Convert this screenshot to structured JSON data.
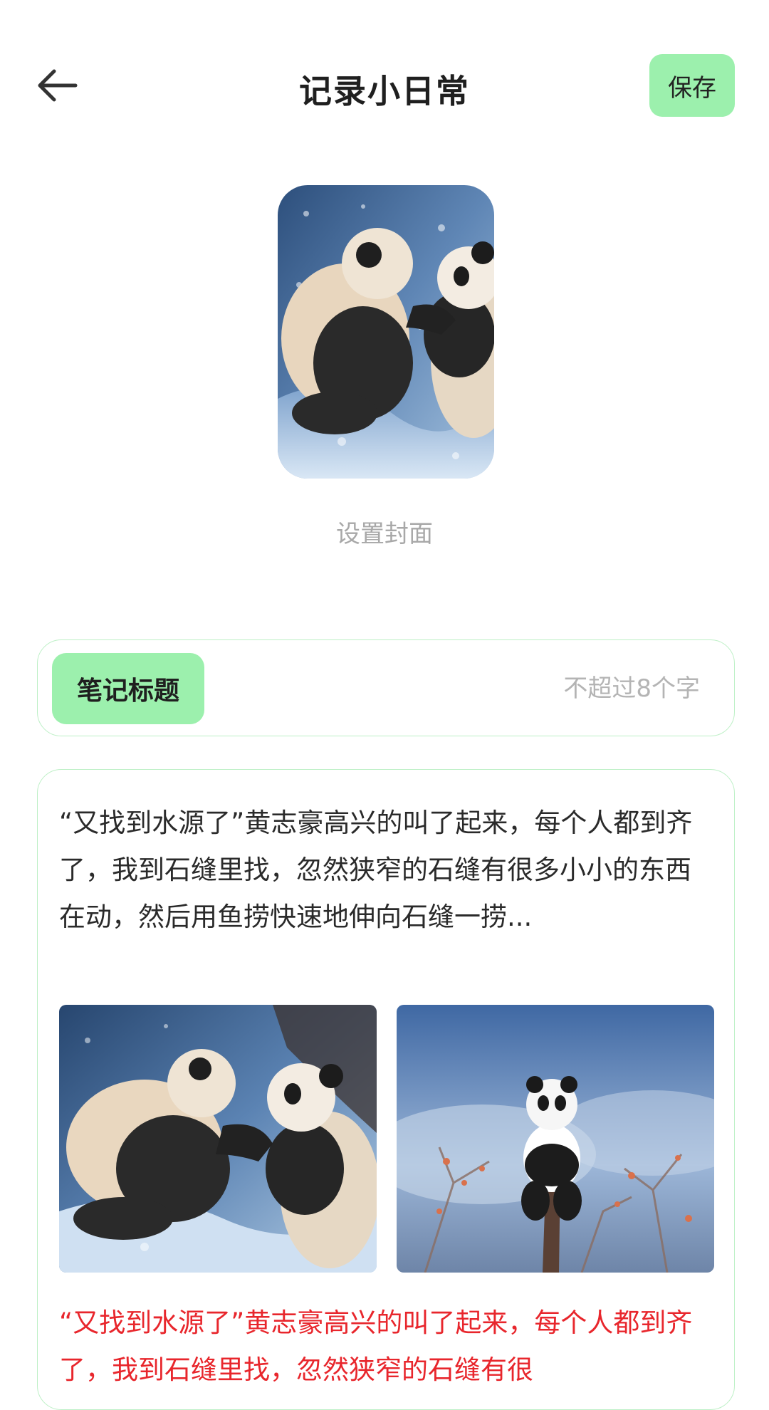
{
  "header": {
    "back_icon": "arrow-left-icon",
    "title": "记录小日常",
    "save_label": "保存",
    "accent_color": "#9cf0ad"
  },
  "cover": {
    "image": "panda-cubs-playing-in-snow",
    "label": "设置封面"
  },
  "note_title": {
    "tag_label": "笔记标题",
    "placeholder": "不超过8个字",
    "value": ""
  },
  "content": {
    "paragraph": "“又找到水源了”黄志豪高兴的叫了起来，每个人都到齐了，我到石缝里找，忽然狭窄的石缝有很多小小的东西在动，然后用鱼捞快速地伸向石缝一捞...",
    "photos": [
      "panda-cubs-playing-in-snow",
      "panda-on-tree-branch"
    ],
    "paragraph_red": "“又找到水源了”黄志豪高兴的叫了起来，每个人都到齐了，我到石缝里找，忽然狭窄的石缝有很",
    "red_color": "#e8262c",
    "border_color": "#bdf0c6"
  }
}
